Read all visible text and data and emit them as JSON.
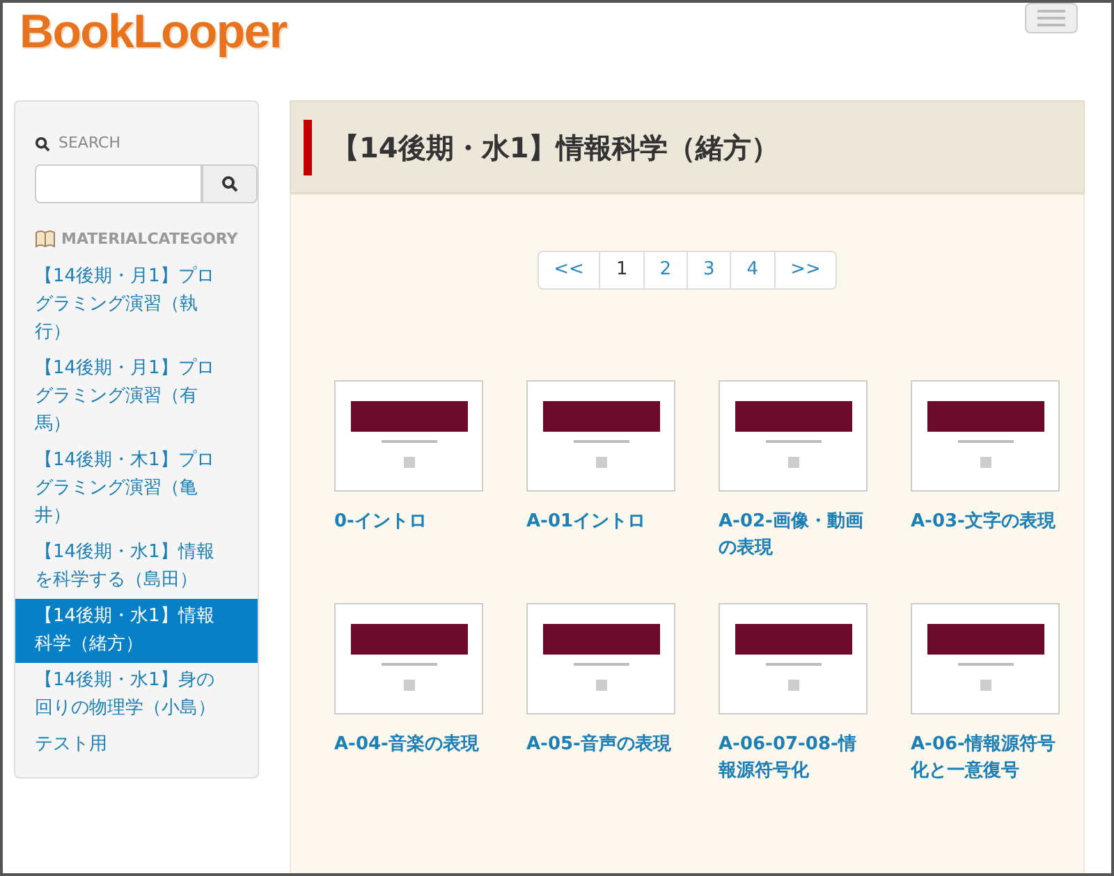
{
  "logo": "BookLooper",
  "sidebar": {
    "search_label": "SEARCH",
    "category_label": "MATERIALCATEGORY",
    "items": [
      {
        "label": "【14後期・月1】プログラミング演習（執行）",
        "selected": false
      },
      {
        "label": "【14後期・月1】プログラミング演習（有馬）",
        "selected": false
      },
      {
        "label": "【14後期・木1】プログラミング演習（亀井）",
        "selected": false
      },
      {
        "label": "【14後期・水1】情報を科学する（島田）",
        "selected": false
      },
      {
        "label": "【14後期・水1】情報科学（緒方）",
        "selected": true
      },
      {
        "label": "【14後期・水1】身の回りの物理学（小島）",
        "selected": false
      },
      {
        "label": "テスト用",
        "selected": false
      }
    ]
  },
  "main": {
    "title": "【14後期・水1】情報科学（緒方）",
    "pagination": [
      {
        "label": "<<",
        "selected": false
      },
      {
        "label": "1",
        "selected": true
      },
      {
        "label": "2",
        "selected": false
      },
      {
        "label": "3",
        "selected": false
      },
      {
        "label": "4",
        "selected": false
      },
      {
        "label": ">>",
        "selected": false
      }
    ],
    "materials": [
      {
        "title": "0-イントロ"
      },
      {
        "title": "A-01イントロ"
      },
      {
        "title": "A-02-画像・動画の表現"
      },
      {
        "title": "A-03-文字の表現"
      },
      {
        "title": "A-04-音楽の表現"
      },
      {
        "title": "A-05-音声の表現"
      },
      {
        "title": "A-06-07-08-情報源符号化"
      },
      {
        "title": "A-06-情報源符号化と一意復号"
      }
    ]
  }
}
